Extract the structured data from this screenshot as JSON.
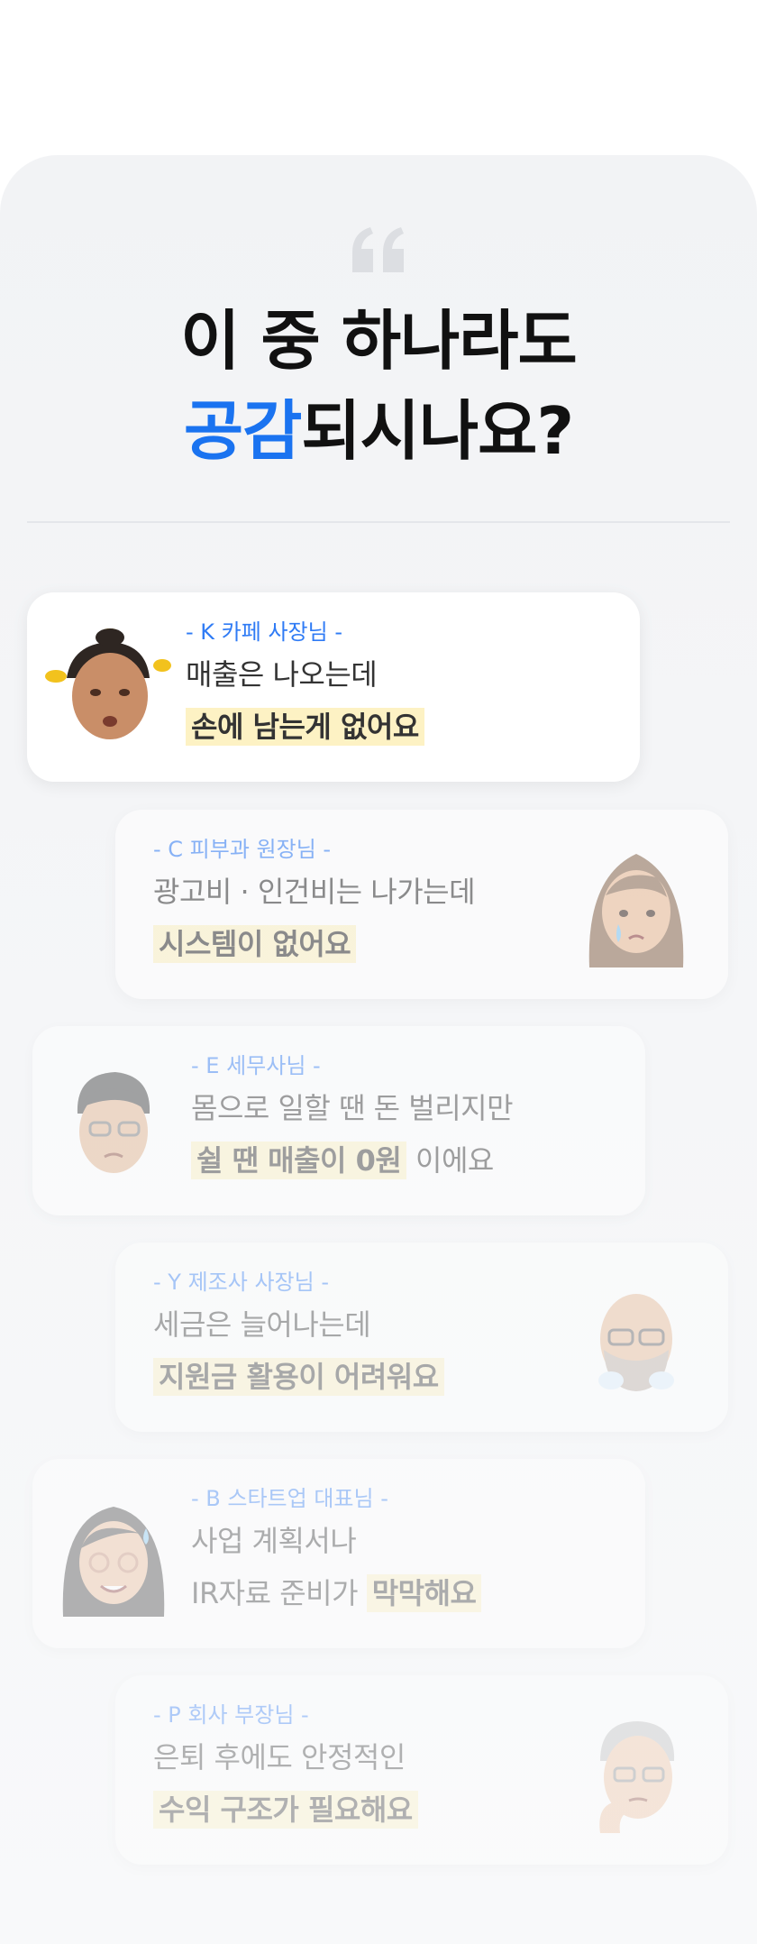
{
  "headline": {
    "line1": "이 중 하나라도",
    "accent": "공감",
    "line2_rest": "되시나요?"
  },
  "colors": {
    "accent": "#1a73f0",
    "tag": "#2f7bf5",
    "highlight": "#fdf2c4"
  },
  "icons": {
    "quote": "quote-icon"
  },
  "testimonials": [
    {
      "tag": "- K 카페 사장님 -",
      "line1": "매출은 나오는데",
      "line2_pre": "",
      "line2_highlight": "손에 남는게 없어요",
      "line2_post": "",
      "avatar": "memoji-stressed-man-avatar"
    },
    {
      "tag": "- C 피부과 원장님 -",
      "line1": "광고비 · 인건비는 나가는데",
      "line2_pre": "",
      "line2_highlight": "시스템이 없어요",
      "line2_post": "",
      "avatar": "memoji-crying-woman-avatar"
    },
    {
      "tag": "- E 세무사님 -",
      "line1": "몸으로 일할 땐 돈 벌리지만",
      "line2_pre": "",
      "line2_highlight": "쉴 땐 매출이 0원",
      "line2_post": " 이에요",
      "avatar": "memoji-worried-man-avatar"
    },
    {
      "tag": "- Y 제조사 사장님 -",
      "line1": "세금은 늘어나는데",
      "line2_pre": "",
      "line2_highlight": "지원금 활용이 어려워요",
      "line2_post": "",
      "avatar": "memoji-bald-man-avatar"
    },
    {
      "tag": "- B 스타트업 대표님 -",
      "line1": "사업 계획서나",
      "line2_pre": "IR자료 준비가 ",
      "line2_highlight": "막막해요",
      "line2_post": "",
      "avatar": "memoji-sweating-woman-avatar"
    },
    {
      "tag": "- P 회사 부장님 -",
      "line1": "은퇴 후에도 안정적인",
      "line2_pre": "",
      "line2_highlight": "수익 구조가 필요해요",
      "line2_post": "",
      "avatar": "memoji-thinking-man-avatar"
    }
  ]
}
